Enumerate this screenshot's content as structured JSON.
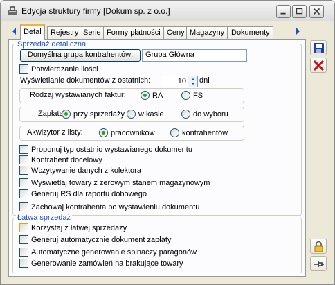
{
  "window": {
    "title": "Edycja struktury firmy [Dokum sp. z o.o.]",
    "icons": {
      "app": "tools-icon",
      "minimize": "minimize-icon",
      "maximize": "maximize-icon",
      "close": "close-icon"
    }
  },
  "tabs": [
    "Detal",
    "Rejestry",
    "Serie",
    "Formy płatności",
    "Ceny",
    "Magazyny",
    "Dokumenty"
  ],
  "active_tab": "Detal",
  "retail": {
    "group_title": "Sprzedaż detaliczna",
    "default_group_button": "Domyślna grupa kontrahentów:",
    "default_group_value": "Grupa Główna",
    "confirm_quantity": "Potwierdzanie ilości",
    "show_docs_label": "Wyświetlanie dokumentów z ostatnich:",
    "show_docs_value": "10",
    "show_docs_unit": "dni",
    "invoice_type_label": "Rodzaj wystawianych faktur:",
    "invoice_type_options": [
      "RA",
      "FS"
    ],
    "invoice_type_selected": "RA",
    "payment_label": "Zapłata:",
    "payment_options": [
      "przy sprzedaży",
      "w kasie",
      "do wyboru"
    ],
    "payment_selected": "przy sprzedaży",
    "acquirer_label": "Akwizytor z listy:",
    "acquirer_options": [
      "pracowników",
      "kontrahentów"
    ],
    "acquirer_selected": "pracowników",
    "checkboxes": [
      "Proponuj typ ostatnio wystawianego dokumentu",
      "Kontrahent docelowy",
      "Wczytywanie danych z kolektora",
      "Wyświetlaj towary z zerowym stanem magazynowym",
      "Generuj RS dla raportu dobowego",
      "Zachowaj kontrahenta po wystawieniu dokumentu"
    ]
  },
  "easy_sale": {
    "group_title": "Łatwa sprzedaż",
    "checkboxes": [
      "Korzystaj z łatwej sprzedaży",
      "Generuj automatycznie dokument zapłaty",
      "Automatyczne generowanie spinaczy paragonów",
      "Generowanie zamówień na brakujące towary"
    ]
  },
  "side_buttons": {
    "save": "save-icon",
    "cancel": "cancel-icon",
    "lock": "lock-icon",
    "pin": "pin-icon"
  },
  "colors": {
    "group_title": "#1a4fc6",
    "cancel_red": "#cc1111",
    "radio_dot": "#21a121",
    "tab_highlight": "#f1b33e"
  }
}
